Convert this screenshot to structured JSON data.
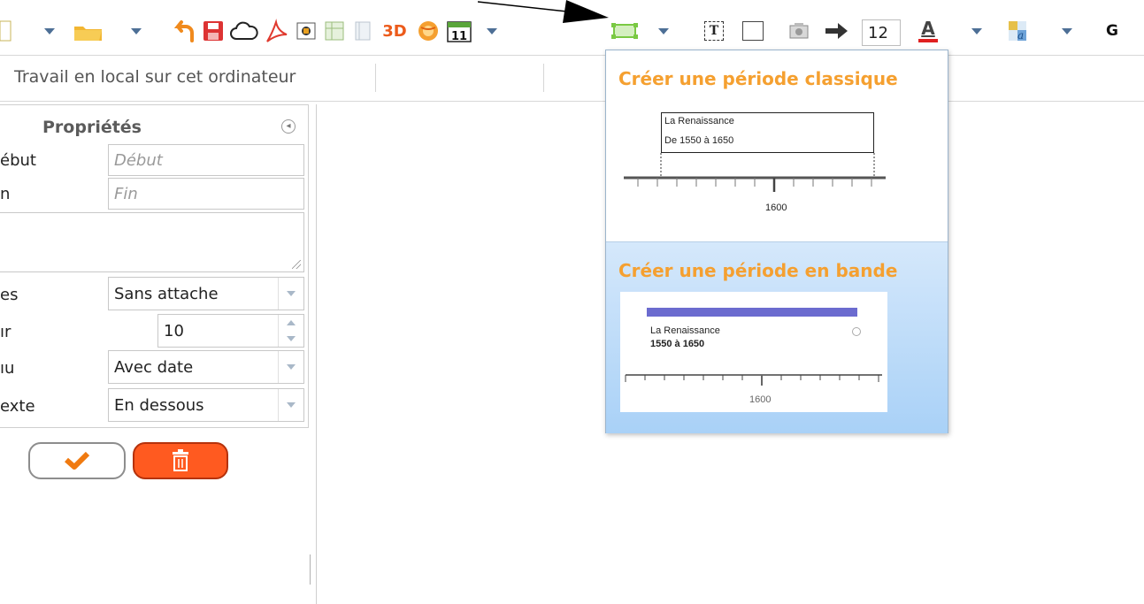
{
  "toolbar": {
    "font_size": "12",
    "label_3d": "3D",
    "calendar_day": "11",
    "text_tool_glyph": "T",
    "font_color_glyph": "A",
    "bold_glyph": "G",
    "icons": [
      "new-document-icon",
      "open-folder-icon",
      "undo-icon",
      "save-icon",
      "cloud-icon",
      "pdf-icon",
      "image-icon",
      "calendar-grid-icon",
      "page-icon",
      "3d-icon",
      "globe-icon",
      "calendar-icon",
      "period-icon",
      "text-icon",
      "frame-icon",
      "media-icon",
      "arrow-right-icon",
      "font-color-icon",
      "background-pattern-icon",
      "bold-icon"
    ],
    "colors": {
      "caret": "#4d6f96",
      "font_color_bar": "#e02020",
      "period_icon": "#7ac943"
    }
  },
  "status": {
    "mode": "Travail en local sur cet ordinateur"
  },
  "properties": {
    "title": "Propriétés",
    "rows": {
      "debut": {
        "label": "ébut",
        "placeholder": "Début"
      },
      "fin": {
        "label": "n",
        "placeholder": "Fin"
      },
      "attache": {
        "label": "es",
        "value": "Sans attache"
      },
      "epaisseur": {
        "label": "ır",
        "value": "10"
      },
      "niveau": {
        "label": "ıu",
        "value": "Avec date"
      },
      "texte": {
        "label": "exte",
        "value": "En dessous"
      }
    }
  },
  "popup": {
    "classic": {
      "title": "Créer une période classique",
      "preview": {
        "name": "La Renaissance",
        "range": "De 1550 à 1650",
        "tick": "1600"
      }
    },
    "band": {
      "title": "Créer une période en bande",
      "preview": {
        "name": "La Renaissance",
        "range": "1550 à 1650",
        "tick": "1600"
      }
    }
  }
}
